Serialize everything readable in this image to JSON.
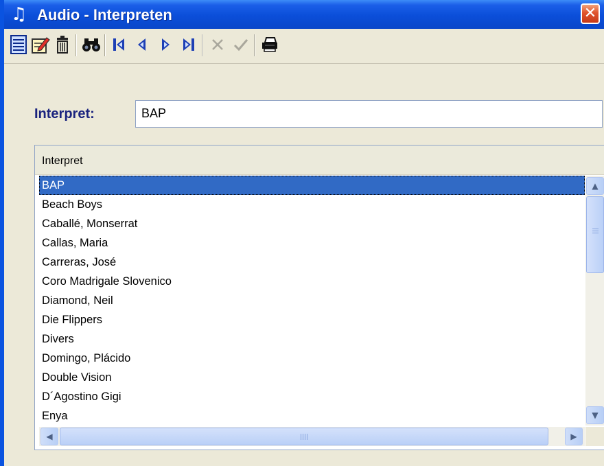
{
  "window": {
    "title": "Audio - Interpreten",
    "title_icon": "music-note-icon",
    "close_glyph": "✕",
    "colors": {
      "titlebar": "#0b4ed9",
      "close": "#e0532c",
      "selection": "#316ac5",
      "label": "#1a237e"
    }
  },
  "toolbar": {
    "buttons": [
      {
        "name": "new-record",
        "icon": "document-list-icon"
      },
      {
        "name": "edit-record",
        "icon": "edit-pencil-icon"
      },
      {
        "name": "delete-record",
        "icon": "trash-icon"
      },
      {
        "name": "search",
        "icon": "binoculars-icon"
      },
      {
        "name": "first-record",
        "icon": "first-icon"
      },
      {
        "name": "previous-record",
        "icon": "previous-icon"
      },
      {
        "name": "next-record",
        "icon": "next-icon"
      },
      {
        "name": "last-record",
        "icon": "last-icon"
      },
      {
        "name": "cancel-edit",
        "icon": "cancel-x-icon",
        "disabled": true
      },
      {
        "name": "confirm-edit",
        "icon": "checkmark-icon",
        "disabled": true
      },
      {
        "name": "print",
        "icon": "printer-icon"
      }
    ]
  },
  "form": {
    "interpret_label": "Interpret:",
    "interpret_value": "BAP"
  },
  "grid": {
    "column_header": "Interpret",
    "selected_index": 0,
    "rows": [
      "BAP",
      "Beach Boys",
      "Caballé, Monserrat",
      "Callas, Maria",
      "Carreras, José",
      "Coro Madrigale Slovenico",
      "Diamond, Neil",
      "Die Flippers",
      "Divers",
      "Domingo, Plácido",
      "Double Vision",
      "D´Agostino Gigi",
      "Enya"
    ]
  },
  "scrollbars": {
    "up_glyph": "▲",
    "down_glyph": "▼",
    "left_glyph": "◀",
    "right_glyph": "▶"
  }
}
